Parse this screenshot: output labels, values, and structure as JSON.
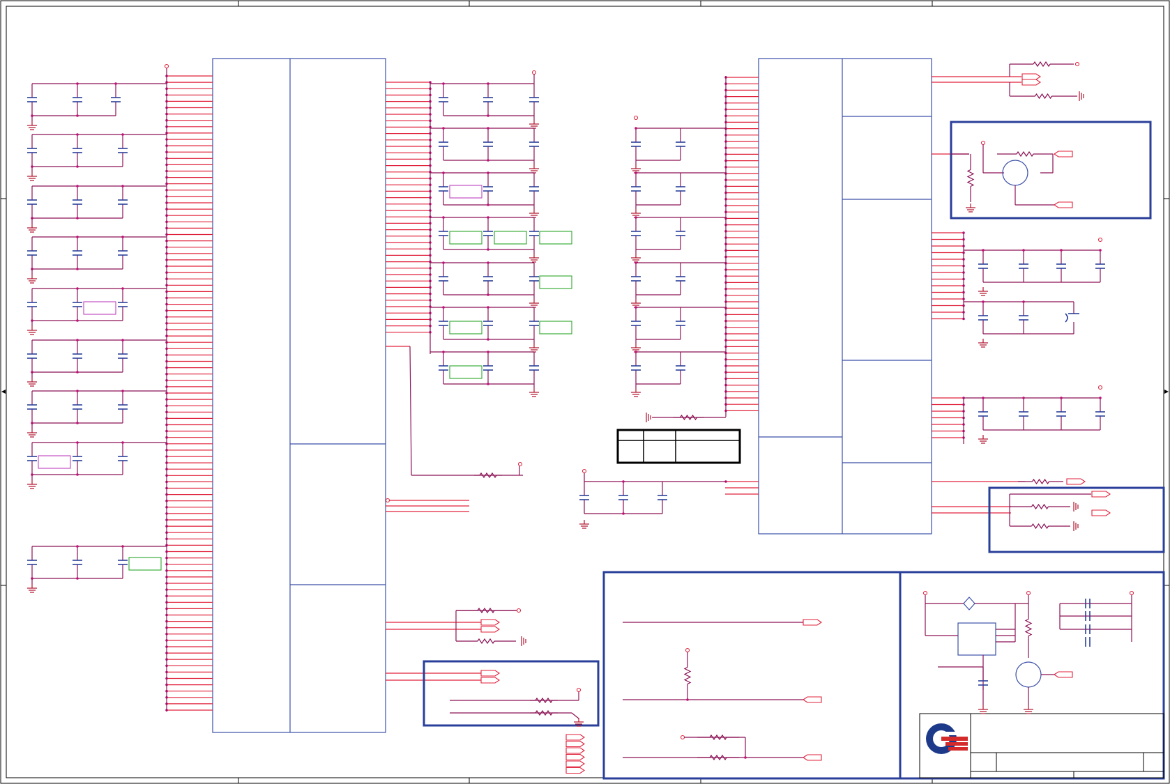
{
  "schematic": {
    "type": "circuit-schematic",
    "colors": {
      "wire": "#b0102a",
      "pin": "#e0203a",
      "part_outline": "#3a4fa8",
      "group_box": "#2a3f9a",
      "junction": "#c0107a",
      "label_box": "#2aa52a",
      "note_box": "#c040c0",
      "logo_red": "#d42a2a",
      "logo_blue": "#1d3a8a"
    },
    "logo": {
      "name": "company-logo-icon"
    },
    "symbols": [
      "capacitor",
      "resistor",
      "ground",
      "mosfet",
      "diode",
      "power-port",
      "off-page-connector"
    ]
  }
}
